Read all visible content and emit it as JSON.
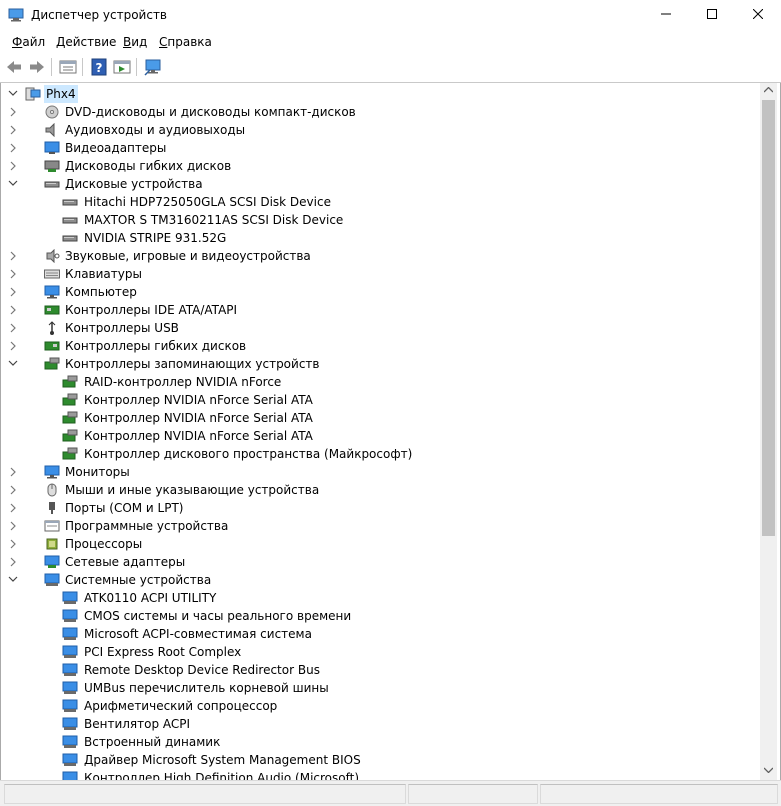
{
  "window": {
    "title": "Диспетчер устройств"
  },
  "window_controls": {
    "minimize": "—",
    "maximize": "☐",
    "close": "✕"
  },
  "menu": [
    {
      "accel": "Ф",
      "rest": "айл"
    },
    {
      "accel": "Д",
      "rest": "ействие"
    },
    {
      "accel": "В",
      "rest": "ид"
    },
    {
      "accel": "С",
      "rest": "правка"
    }
  ],
  "toolbar": {
    "buttons": [
      "back-icon",
      "forward-icon",
      "properties-icon",
      "help-icon",
      "update-driver-icon",
      "scan-hardware-icon"
    ]
  },
  "tree": {
    "root": {
      "label": "Phx4",
      "icon": "computer-icon",
      "expanded": true
    },
    "items": [
      {
        "label": "DVD-дисководы и дисководы компакт-дисков",
        "level": 1,
        "expander": "collapsed",
        "icon": "dvd-drive-icon"
      },
      {
        "label": "Аудиовходы и аудиовыходы",
        "level": 1,
        "expander": "collapsed",
        "icon": "speaker-icon"
      },
      {
        "label": "Видеоадаптеры",
        "level": 1,
        "expander": "collapsed",
        "icon": "display-adapter-icon"
      },
      {
        "label": "Дисководы гибких дисков",
        "level": 1,
        "expander": "collapsed",
        "icon": "floppy-drive-icon"
      },
      {
        "label": "Дисковые устройства",
        "level": 1,
        "expander": "expanded",
        "icon": "disk-drive-icon"
      },
      {
        "label": "Hitachi HDP725050GLA SCSI Disk Device",
        "level": 2,
        "expander": "none",
        "icon": "disk-drive-icon"
      },
      {
        "label": "MAXTOR S TM3160211AS SCSI Disk Device",
        "level": 2,
        "expander": "none",
        "icon": "disk-drive-icon"
      },
      {
        "label": "NVIDIA  STRIPE   931.52G",
        "level": 2,
        "expander": "none",
        "icon": "disk-drive-icon"
      },
      {
        "label": "Звуковые, игровые и видеоустройства",
        "level": 1,
        "expander": "collapsed",
        "icon": "sound-icon"
      },
      {
        "label": "Клавиатуры",
        "level": 1,
        "expander": "collapsed",
        "icon": "keyboard-icon"
      },
      {
        "label": "Компьютер",
        "level": 1,
        "expander": "collapsed",
        "icon": "monitor-icon"
      },
      {
        "label": "Контроллеры IDE ATA/ATAPI",
        "level": 1,
        "expander": "collapsed",
        "icon": "ide-controller-icon"
      },
      {
        "label": "Контроллеры USB",
        "level": 1,
        "expander": "collapsed",
        "icon": "usb-icon"
      },
      {
        "label": "Контроллеры гибких дисков",
        "level": 1,
        "expander": "collapsed",
        "icon": "floppy-controller-icon"
      },
      {
        "label": "Контроллеры запоминающих устройств",
        "level": 1,
        "expander": "expanded",
        "icon": "storage-controller-icon"
      },
      {
        "label": "RAID-контроллер NVIDIA nForce",
        "level": 2,
        "expander": "none",
        "icon": "storage-controller-icon"
      },
      {
        "label": "Контроллер NVIDIA nForce Serial ATA",
        "level": 2,
        "expander": "none",
        "icon": "storage-controller-icon"
      },
      {
        "label": "Контроллер NVIDIA nForce Serial ATA",
        "level": 2,
        "expander": "none",
        "icon": "storage-controller-icon"
      },
      {
        "label": "Контроллер NVIDIA nForce Serial ATA",
        "level": 2,
        "expander": "none",
        "icon": "storage-controller-icon"
      },
      {
        "label": "Контроллер дискового пространства (Майкрософт)",
        "level": 2,
        "expander": "none",
        "icon": "storage-controller-icon"
      },
      {
        "label": "Мониторы",
        "level": 1,
        "expander": "collapsed",
        "icon": "monitor-icon"
      },
      {
        "label": "Мыши и иные указывающие устройства",
        "level": 1,
        "expander": "collapsed",
        "icon": "mouse-icon"
      },
      {
        "label": "Порты (COM и LPT)",
        "level": 1,
        "expander": "collapsed",
        "icon": "port-icon"
      },
      {
        "label": "Программные устройства",
        "level": 1,
        "expander": "collapsed",
        "icon": "software-device-icon"
      },
      {
        "label": "Процессоры",
        "level": 1,
        "expander": "collapsed",
        "icon": "processor-icon"
      },
      {
        "label": "Сетевые адаптеры",
        "level": 1,
        "expander": "collapsed",
        "icon": "network-adapter-icon"
      },
      {
        "label": "Системные устройства",
        "level": 1,
        "expander": "expanded",
        "icon": "system-device-icon"
      },
      {
        "label": "ATK0110 ACPI UTILITY",
        "level": 2,
        "expander": "none",
        "icon": "system-device-icon"
      },
      {
        "label": "CMOS системы и часы реального времени",
        "level": 2,
        "expander": "none",
        "icon": "system-device-icon"
      },
      {
        "label": "Microsoft ACPI-совместимая система",
        "level": 2,
        "expander": "none",
        "icon": "system-device-icon"
      },
      {
        "label": "PCI Express Root Complex",
        "level": 2,
        "expander": "none",
        "icon": "system-device-icon"
      },
      {
        "label": "Remote Desktop Device Redirector Bus",
        "level": 2,
        "expander": "none",
        "icon": "system-device-icon"
      },
      {
        "label": "UMBus перечислитель корневой шины",
        "level": 2,
        "expander": "none",
        "icon": "system-device-icon"
      },
      {
        "label": "Арифметический сопроцессор",
        "level": 2,
        "expander": "none",
        "icon": "system-device-icon"
      },
      {
        "label": "Вентилятор ACPI",
        "level": 2,
        "expander": "none",
        "icon": "system-device-icon"
      },
      {
        "label": "Встроенный динамик",
        "level": 2,
        "expander": "none",
        "icon": "system-device-icon"
      },
      {
        "label": "Драйвер Microsoft System Management BIOS",
        "level": 2,
        "expander": "none",
        "icon": "system-device-icon"
      },
      {
        "label": "Контроллер High Definition Audio (Microsoft)",
        "level": 2,
        "expander": "none",
        "icon": "system-device-icon"
      }
    ]
  },
  "colors": {
    "selection": "#cce8ff",
    "monitor_blue": "#3a8ee6",
    "frame": "#aaaaaa"
  }
}
